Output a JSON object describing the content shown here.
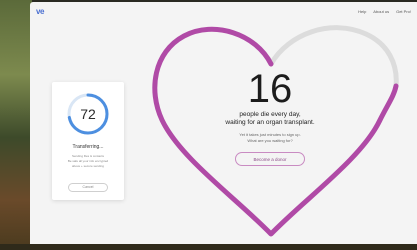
{
  "header": {
    "logo": "ve",
    "nav": [
      "Help",
      "About us",
      "Get Pro!"
    ]
  },
  "hero": {
    "count": "16",
    "line1": "people die every day,",
    "line2": "waiting for an organ transplant.",
    "sub1": "Yet it takes just minutes to sign up.",
    "sub2": "What are you waiting for?",
    "cta_label": "Become a donor"
  },
  "transfer": {
    "progress_value": "72",
    "progress_fraction": 0.72,
    "title": "Transferring...",
    "lines": [
      "Sending files & contacts",
      "Be safe all your info encrypted",
      "above + secure sending"
    ],
    "cancel_label": "Cancel"
  },
  "colors": {
    "heart": "#b04aa6",
    "gauge_arc": "#4d8fe0",
    "gauge_track": "#d9e6f5",
    "logo": "#4a6fd1"
  }
}
